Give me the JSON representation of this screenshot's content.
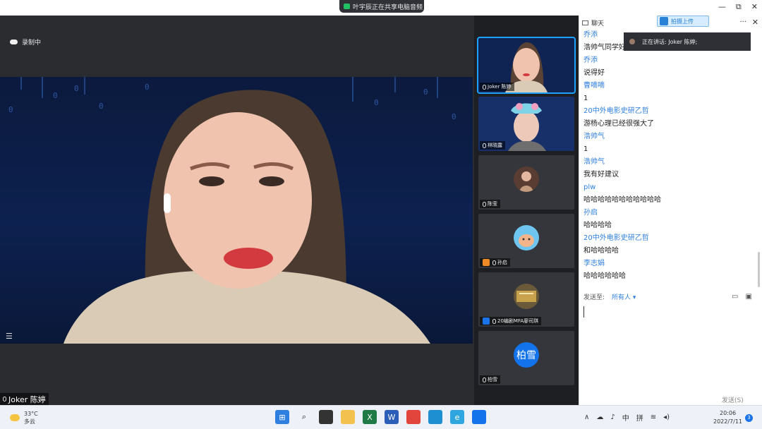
{
  "share_banner": "叶宇辰正在共享电脑音频",
  "window_controls": [
    "—",
    "⧉",
    "✕"
  ],
  "stage": {
    "recording_label": "录制中",
    "speaker_name": "Joker 陈婷"
  },
  "participants": [
    {
      "name": "Joker 陈婷",
      "type": "video"
    },
    {
      "name": "林晓露",
      "type": "video"
    },
    {
      "name": "陈莹",
      "type": "avatar"
    },
    {
      "name": "孙启",
      "type": "avatar"
    },
    {
      "name": "20编剧MFA廖司琪",
      "type": "avatar"
    },
    {
      "name": "柏雪",
      "type": "text-avatar",
      "avatar_text": "柏雪"
    }
  ],
  "chat": {
    "title": "聊天",
    "upload_button": "拍摄上传",
    "speaking_toast": "正在讲话: Joker 陈婷;",
    "messages": [
      {
        "name": "乔添",
        "text": "浩帅气同学好"
      },
      {
        "name": "乔添",
        "text": "说得好"
      },
      {
        "name": "曹嘀嘀",
        "text": "1"
      },
      {
        "name": "20中外电影史研乙哲",
        "text": "游杨心理已经很强大了"
      },
      {
        "name": "浩帅气",
        "text": "1"
      },
      {
        "name": "浩帅气",
        "text": "我有好建议"
      },
      {
        "name": "plw",
        "text": "哈哈哈哈哈哈哈哈哈哈哈"
      },
      {
        "name": "孙启",
        "text": "哈哈哈哈"
      },
      {
        "name": "20中外电影史研乙哲",
        "text": "和哈哈哈哈"
      },
      {
        "name": "李志娟",
        "text": "哈哈哈哈哈哈"
      }
    ],
    "send_to_label": "发送至:",
    "send_to_value": "所有人 ▾",
    "send_button": "发送(S)"
  },
  "taskbar": {
    "temperature": "33°C",
    "weather": "多云",
    "tray_ime": "中",
    "tray_ime2": "拼",
    "time": "20:06",
    "date": "2022/7/11",
    "notifications": "3"
  },
  "colors": {
    "accent": "#2f7fe0",
    "active_border": "#1ea0ff"
  }
}
